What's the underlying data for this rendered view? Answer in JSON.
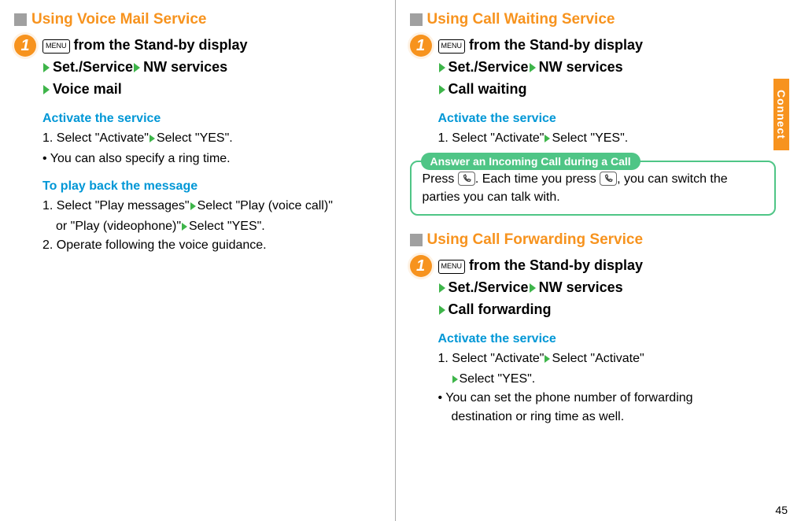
{
  "side_tab": "Connect",
  "page_number": "45",
  "menu_key_label": "MENU",
  "sec_voice": {
    "title": "Using Voice Mail Service",
    "step_num": "1",
    "line1_before": " from the Stand-by display",
    "line2_a": "Set./Service",
    "line2_b": "NW services",
    "line3": "Voice mail",
    "activate_head": "Activate the service",
    "activate_1_a": "1. Select \"Activate\"",
    "activate_1_b": "Select \"YES\".",
    "activate_note": " • You can also specify a ring time.",
    "play_head": "To play back the message",
    "play_1_a": "1. Select \"Play messages\"",
    "play_1_b": "Select \"Play (voice call)\"",
    "play_1_c": "or \"Play (videophone)\"",
    "play_1_d": "Select \"YES\".",
    "play_2": "2. Operate following the voice guidance."
  },
  "sec_wait": {
    "title": "Using Call Waiting Service",
    "step_num": "1",
    "line1_before": " from the Stand-by display",
    "line2_a": "Set./Service",
    "line2_b": "NW services",
    "line3": "Call waiting",
    "activate_head": "Activate the service",
    "activate_1_a": "1. Select \"Activate\"",
    "activate_1_b": "Select \"YES\".",
    "callout_label": "Answer an Incoming Call during a Call",
    "callout_a": "Press ",
    "callout_b": ". Each time you press ",
    "callout_c": ", you can switch the parties you can talk with."
  },
  "sec_fwd": {
    "title": "Using Call Forwarding Service",
    "step_num": "1",
    "line1_before": " from the Stand-by display",
    "line2_a": "Set./Service",
    "line2_b": "NW services",
    "line3": "Call forwarding",
    "activate_head": "Activate the service",
    "activate_1_a": "1. Select \"Activate\"",
    "activate_1_b": "Select \"Activate\"",
    "activate_2": "Select \"YES\".",
    "activate_note_a": " • You can set the phone number of forwarding",
    "activate_note_b": "destination or ring time as well."
  }
}
